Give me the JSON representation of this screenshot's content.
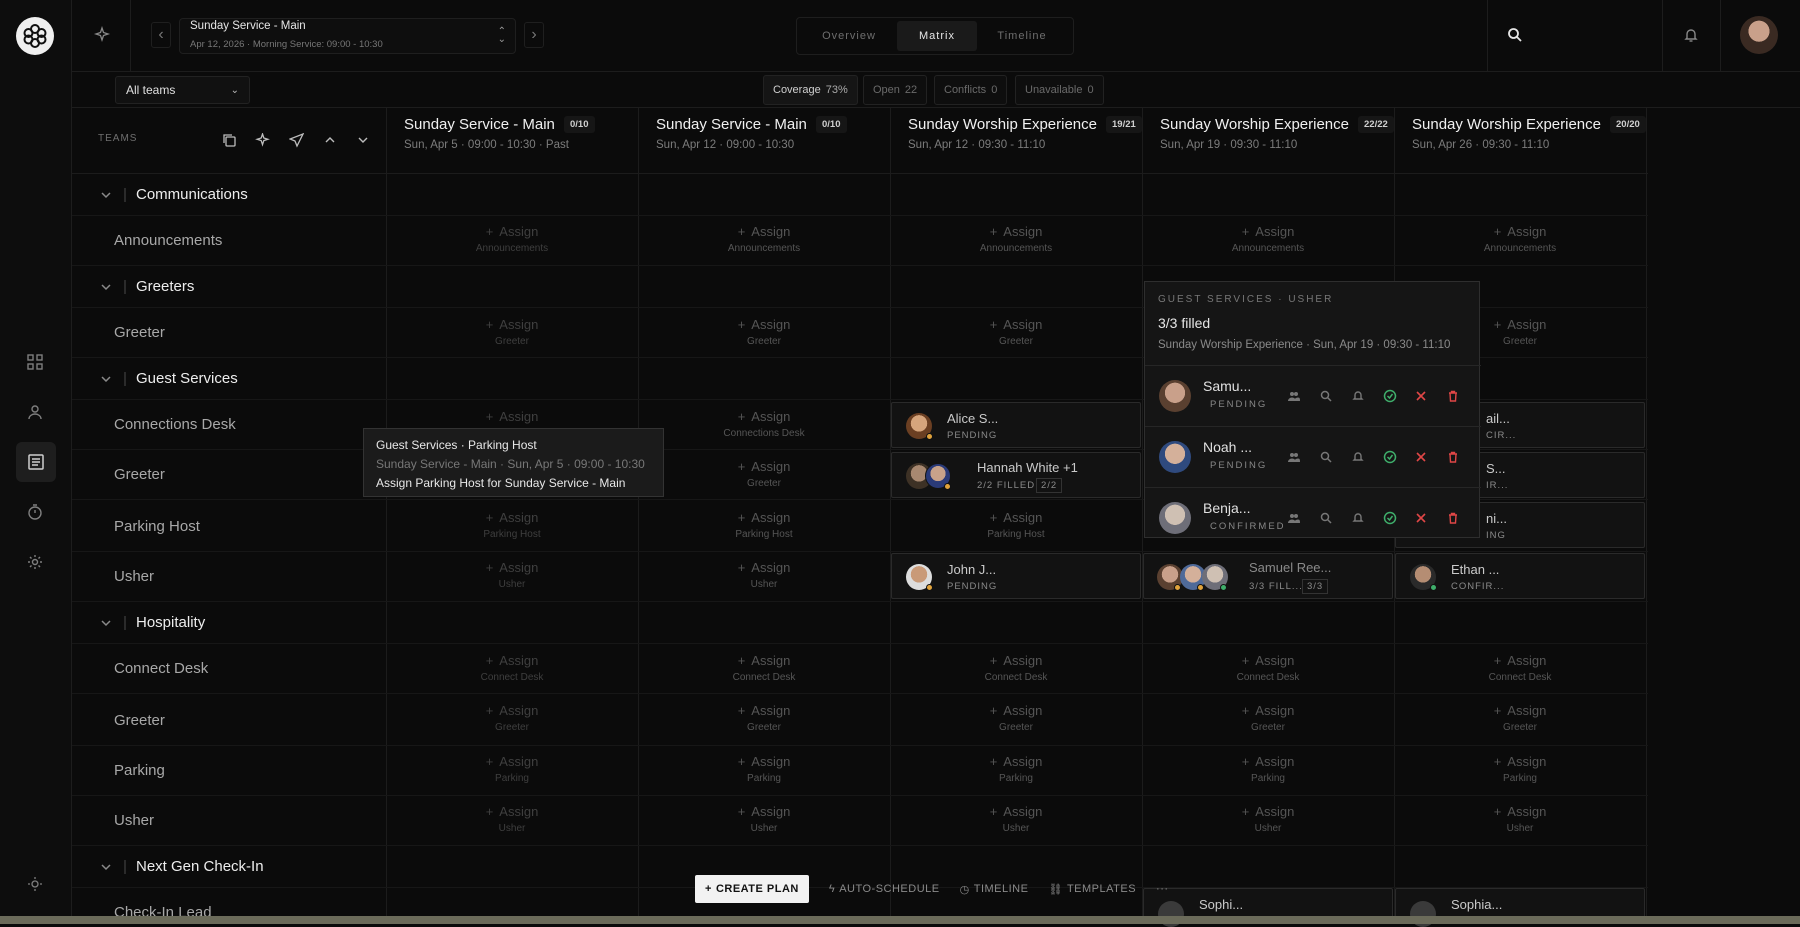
{
  "plan": {
    "title": "Sunday Service - Main",
    "subtitle": "Apr 12, 2026 · Morning Service: 09:00 - 10:30"
  },
  "view_tabs": [
    "Overview",
    "Matrix",
    "Timeline"
  ],
  "filter": {
    "team": "All teams",
    "chips": [
      {
        "label": "Coverage",
        "value": "73%"
      },
      {
        "label": "Open",
        "value": "22"
      },
      {
        "label": "Conflicts",
        "value": "0"
      },
      {
        "label": "Unavailable",
        "value": "0"
      }
    ]
  },
  "teams_label": "TEAMS",
  "columns": [
    {
      "title": "Sunday Service - Main",
      "badge": "0/10",
      "sub": "Sun, Apr 5 · 09:00 - 10:30 · Past"
    },
    {
      "title": "Sunday Service - Main",
      "badge": "0/10",
      "sub": "Sun, Apr 12 · 09:00 - 10:30"
    },
    {
      "title": "Sunday Worship Experience",
      "badge": "19/21",
      "sub": "Sun, Apr 12 · 09:30 - 11:10"
    },
    {
      "title": "Sunday Worship Experience",
      "badge": "22/22",
      "sub": "Sun, Apr 19 · 09:30 - 11:10"
    },
    {
      "title": "Sunday Worship Experience",
      "badge": "20/20",
      "sub": "Sun, Apr 26 · 09:30 - 11:10"
    }
  ],
  "assign_label": "Assign",
  "groups": [
    {
      "name": "Communications"
    },
    {
      "name": "Greeters"
    },
    {
      "name": "Guest Services"
    },
    {
      "name": "Hospitality"
    },
    {
      "name": "Next Gen Check-In"
    }
  ],
  "roles": {
    "announcements": "Announcements",
    "greeter": "Greeter",
    "connections_desk": "Connections Desk",
    "parking_host": "Parking Host",
    "usher": "Usher",
    "connect_desk": "Connect Desk",
    "parking": "Parking",
    "check_in_lead": "Check-In Lead"
  },
  "assignments": {
    "alice": {
      "name": "Alice S...",
      "status": "PENDING"
    },
    "hannah": {
      "name": "Hannah White +1",
      "status": "2/2 FILLED",
      "count": "2/2"
    },
    "john": {
      "name": "John J...",
      "status": "PENDING"
    },
    "samuel": {
      "name": "Samuel Ree...",
      "status": "3/3 FILL...",
      "count": "3/3"
    },
    "ethan": {
      "name": "Ethan ...",
      "status": "CONFIR..."
    },
    "c5_conn": {
      "name": "ail...",
      "status": "CIR..."
    },
    "c5_greet": {
      "name": "S...",
      "status": "IR..."
    },
    "c5_park": {
      "name": "ni...",
      "status": "ING"
    },
    "sophi1": {
      "name": "Sophi..."
    },
    "sophi2": {
      "name": "Sophia..."
    }
  },
  "tooltip": {
    "line1": "Guest Services · Parking Host",
    "line2": "Sunday Service - Main · Sun, Apr 5 · 09:00 - 10:30",
    "line3": "Assign Parking Host for Sunday Service - Main"
  },
  "popover": {
    "eyebrow": "GUEST SERVICES · USHER",
    "title": "3/3 filled",
    "sub": "Sunday Worship Experience · Sun, Apr 19 · 09:30 - 11:10",
    "people": [
      {
        "name": "Samu...",
        "status": "PENDING"
      },
      {
        "name": "Noah ...",
        "status": "PENDING"
      },
      {
        "name": "Benja...",
        "status": "CONFIRMED"
      }
    ]
  },
  "bottom_actions": [
    "CREATE PLAN",
    "AUTO-SCHEDULE",
    "TIMELINE",
    "TEMPLATES"
  ],
  "colors": {
    "accent_green": "#3fae6b",
    "danger": "#e04646",
    "pending": "#e0a33c"
  }
}
